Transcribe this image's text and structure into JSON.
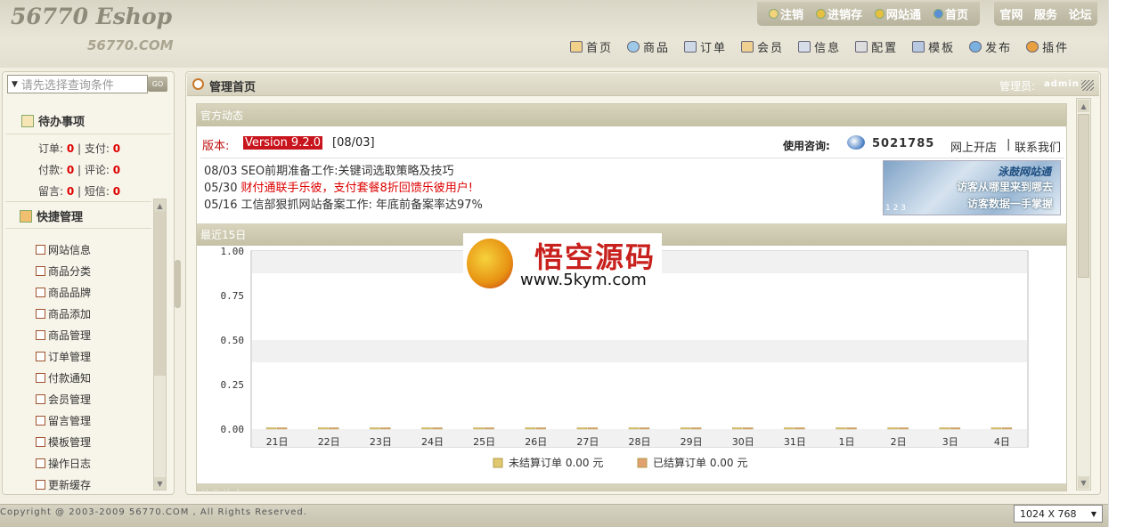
{
  "header": {
    "logo_title": "56770 Eshop",
    "logo_sub": "56770.COM",
    "top_links": [
      {
        "label": "注销",
        "icon": "logout-icon"
      },
      {
        "label": "进销存",
        "icon": "inventory-icon"
      },
      {
        "label": "网站通",
        "icon": "site-icon"
      },
      {
        "label": "首页",
        "icon": "ie-home-icon"
      }
    ],
    "top_links2": [
      "官网",
      "服务",
      "论坛"
    ],
    "nav": [
      {
        "label": "首页",
        "icon": "home-icon"
      },
      {
        "label": "商品",
        "icon": "goods-icon"
      },
      {
        "label": "订单",
        "icon": "order-icon"
      },
      {
        "label": "会员",
        "icon": "member-icon"
      },
      {
        "label": "信息",
        "icon": "info-icon"
      },
      {
        "label": "配置",
        "icon": "config-icon"
      },
      {
        "label": "模板",
        "icon": "template-icon"
      },
      {
        "label": "发布",
        "icon": "publish-icon"
      },
      {
        "label": "插件",
        "icon": "plugin-icon"
      }
    ]
  },
  "sidebar": {
    "search_placeholder": "请先选择查询条件",
    "search_button": "GO",
    "todo_title": "待办事项",
    "todo": {
      "order_label": "订单:",
      "order_value": "0",
      "pay_label": "支付:",
      "pay_value": "0",
      "paid_label": "付款:",
      "paid_value": "0",
      "comment_label": "评论:",
      "comment_value": "0",
      "msg_label": "留言:",
      "msg_value": "0",
      "sms_label": "短信:",
      "sms_value": "0"
    },
    "quick_title": "快捷管理",
    "menu": [
      "网站信息",
      "商品分类",
      "商品品牌",
      "商品添加",
      "商品管理",
      "订单管理",
      "付款通知",
      "会员管理",
      "留言管理",
      "模板管理",
      "操作日志",
      "更新缓存"
    ]
  },
  "main": {
    "title": "管理首页",
    "admin_label": "管理员:",
    "admin_name": "admin",
    "official_title": "官方动态",
    "version_label": "版本:",
    "version_value": "Version 9.2.0",
    "version_date": "[08/03]",
    "consult_label": "使用咨询:",
    "qq_number": "5021785",
    "open_shop": "网上开店",
    "contact": "联系我们",
    "news": [
      {
        "date": "08/03",
        "text": "SEO前期准备工作:关键词选取策略及技巧",
        "highlight": false
      },
      {
        "date": "05/30",
        "text": "财付通联手乐彼，支付套餐8折回馈乐彼用户!",
        "highlight": true
      },
      {
        "date": "05/16",
        "text": "工信部狠抓网站备案工作: 年底前备案率达97%",
        "highlight": false
      }
    ],
    "ad": {
      "line1": "泳鼓网站通",
      "line2": "访客从哪里来到哪去",
      "line3": "访客数据一手掌握",
      "pages": "1 2 3"
    },
    "chart_title": "最近15日",
    "next_panel_title": "软件信息"
  },
  "chart_data": {
    "type": "bar",
    "categories": [
      "21日",
      "22日",
      "23日",
      "24日",
      "25日",
      "26日",
      "27日",
      "28日",
      "29日",
      "30日",
      "31日",
      "1日",
      "2日",
      "3日",
      "4日"
    ],
    "series": [
      {
        "name": "未结算订单",
        "values": [
          0,
          0,
          0,
          0,
          0,
          0,
          0,
          0,
          0,
          0,
          0,
          0,
          0,
          0,
          0
        ],
        "color": "#e0c870"
      },
      {
        "name": "已结算订单",
        "values": [
          0,
          0,
          0,
          0,
          0,
          0,
          0,
          0,
          0,
          0,
          0,
          0,
          0,
          0,
          0
        ],
        "color": "#e0a070"
      }
    ],
    "yticks": [
      "1.00",
      "0.75",
      "0.50",
      "0.25",
      "0.00"
    ],
    "ylim": [
      0,
      1
    ],
    "legend": [
      {
        "name": "未结算订单",
        "value": "0.00",
        "unit": "元"
      },
      {
        "name": "已结算订单",
        "value": "0.00",
        "unit": "元"
      }
    ],
    "legend_position": "bottom"
  },
  "watermark": {
    "title": "悟空源码",
    "url": "www.5kym.com"
  },
  "footer": {
    "copyright": "Copyright @ 2003-2009 56770.COM , All Rights Reserved.",
    "resolution": "1024 X 768"
  },
  "colors": {
    "accent_red": "#dd0000",
    "header_bg": "#e2dfcf",
    "panel_head": "#c5c1a6"
  }
}
